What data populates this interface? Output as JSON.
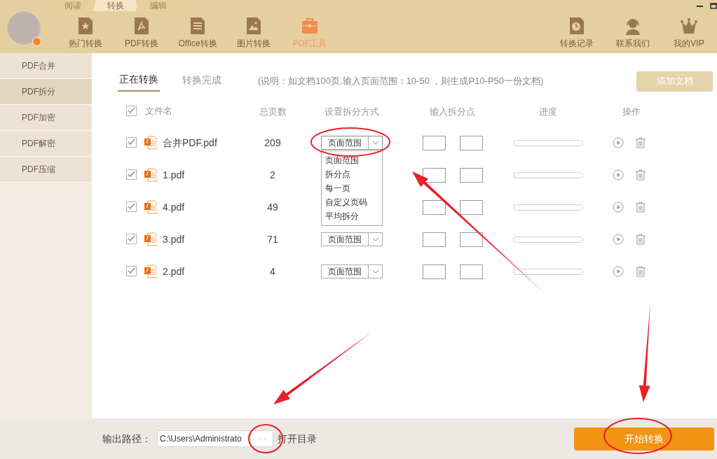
{
  "top_tabs": [
    {
      "label": "阅读",
      "selected": false
    },
    {
      "label": "转换",
      "selected": true
    },
    {
      "label": "编辑",
      "selected": false
    }
  ],
  "toolbar": [
    {
      "label": "热门转换",
      "selected": false
    },
    {
      "label": "PDF转换",
      "selected": false
    },
    {
      "label": "Office转换",
      "selected": false
    },
    {
      "label": "图片转换",
      "selected": false
    },
    {
      "label": "PDF工具",
      "selected": true
    }
  ],
  "toolbar_right": [
    {
      "label": "转换记录"
    },
    {
      "label": "联系我们"
    },
    {
      "label": "我的VIP"
    }
  ],
  "sidebar": {
    "items": [
      {
        "label": "PDF合并",
        "selected": false
      },
      {
        "label": "PDF拆分",
        "selected": true
      },
      {
        "label": "PDF加密",
        "selected": false
      },
      {
        "label": "PDF解密",
        "selected": false
      },
      {
        "label": "PDF压缩",
        "selected": false
      }
    ]
  },
  "sub_tabs": [
    {
      "label": "正在转换",
      "selected": true
    },
    {
      "label": "转换完成",
      "selected": false
    }
  ],
  "note": "(说明：如文档100页,输入页面范围：10-50 ，则生成P10-P50一份文档)",
  "add_button": "添加文档",
  "table": {
    "select_all_checked": true,
    "columns": [
      "文件名",
      "总页数",
      "设置拆分方式",
      "输入拆分点",
      "进度",
      "操作"
    ],
    "rows": [
      {
        "checked": true,
        "name": "合并PDF.pdf",
        "pages": "209",
        "mode": "页面范围",
        "level": 0,
        "expanded": true
      },
      {
        "checked": true,
        "name": "1.pdf",
        "pages": "2",
        "level": 0
      },
      {
        "checked": true,
        "name": "4.pdf",
        "pages": "49",
        "level": 0
      },
      {
        "checked": true,
        "name": "3.pdf",
        "pages": "71",
        "mode": "页面范围",
        "level": 0,
        "expanded": false
      },
      {
        "checked": true,
        "name": "2.pdf",
        "pages": "4",
        "mode": "页面范围",
        "level": 0,
        "expanded": false
      }
    ]
  },
  "dropdown_options": [
    "页面范围",
    "拆分点",
    "每一页",
    "自定义页码",
    "平均拆分"
  ],
  "footer": {
    "path_label": "输出路径：",
    "path_value": "C:\\Users\\Administrato",
    "browse": "···",
    "open_dir": "打开目录",
    "start_button": "开始转换"
  },
  "annotations": [
    {
      "kind": "ellipse"
    },
    {
      "kind": "ellipse"
    },
    {
      "kind": "ellipse"
    },
    {
      "kind": "arrow"
    },
    {
      "kind": "arrow"
    },
    {
      "kind": "arrow"
    }
  ]
}
